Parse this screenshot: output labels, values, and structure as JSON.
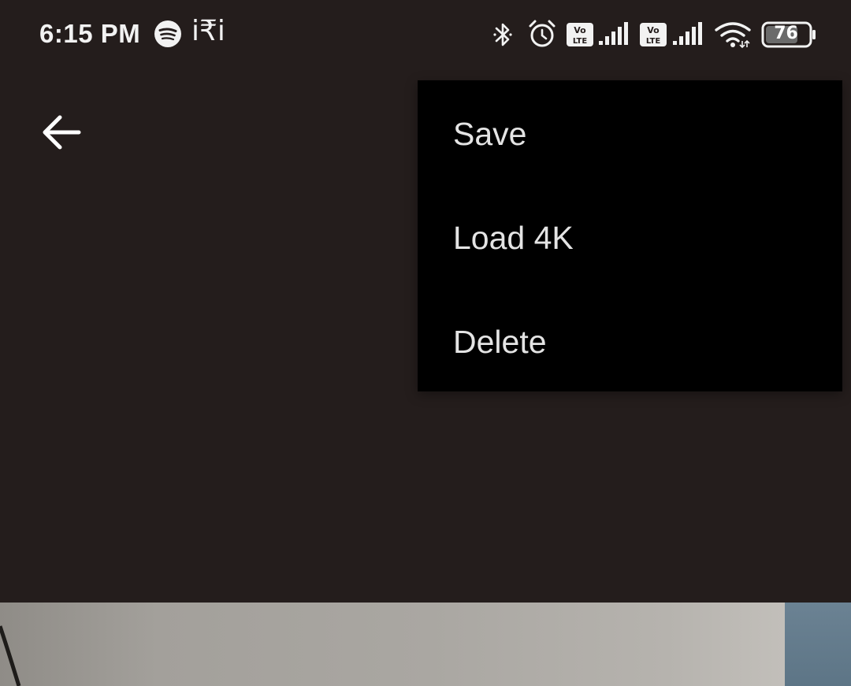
{
  "status_bar": {
    "time": "6:15 PM",
    "rupee_glyph": "i₹i",
    "battery_level": "76",
    "icons": [
      "spotify-icon",
      "rupee-icon",
      "bluetooth-icon",
      "alarm-icon",
      "volte-icon",
      "signal-icon",
      "volte-icon",
      "signal-icon",
      "wifi-icon",
      "battery-icon"
    ]
  },
  "app_bar": {
    "back_icon": "arrow-left-icon"
  },
  "menu": {
    "items": [
      {
        "label": "Save"
      },
      {
        "label": "Load 4K"
      },
      {
        "label": "Delete"
      }
    ]
  },
  "colors": {
    "background": "#241d1c",
    "menu_background": "#000000",
    "menu_text": "#e4e4e4",
    "status_text": "#f2f2f2"
  }
}
